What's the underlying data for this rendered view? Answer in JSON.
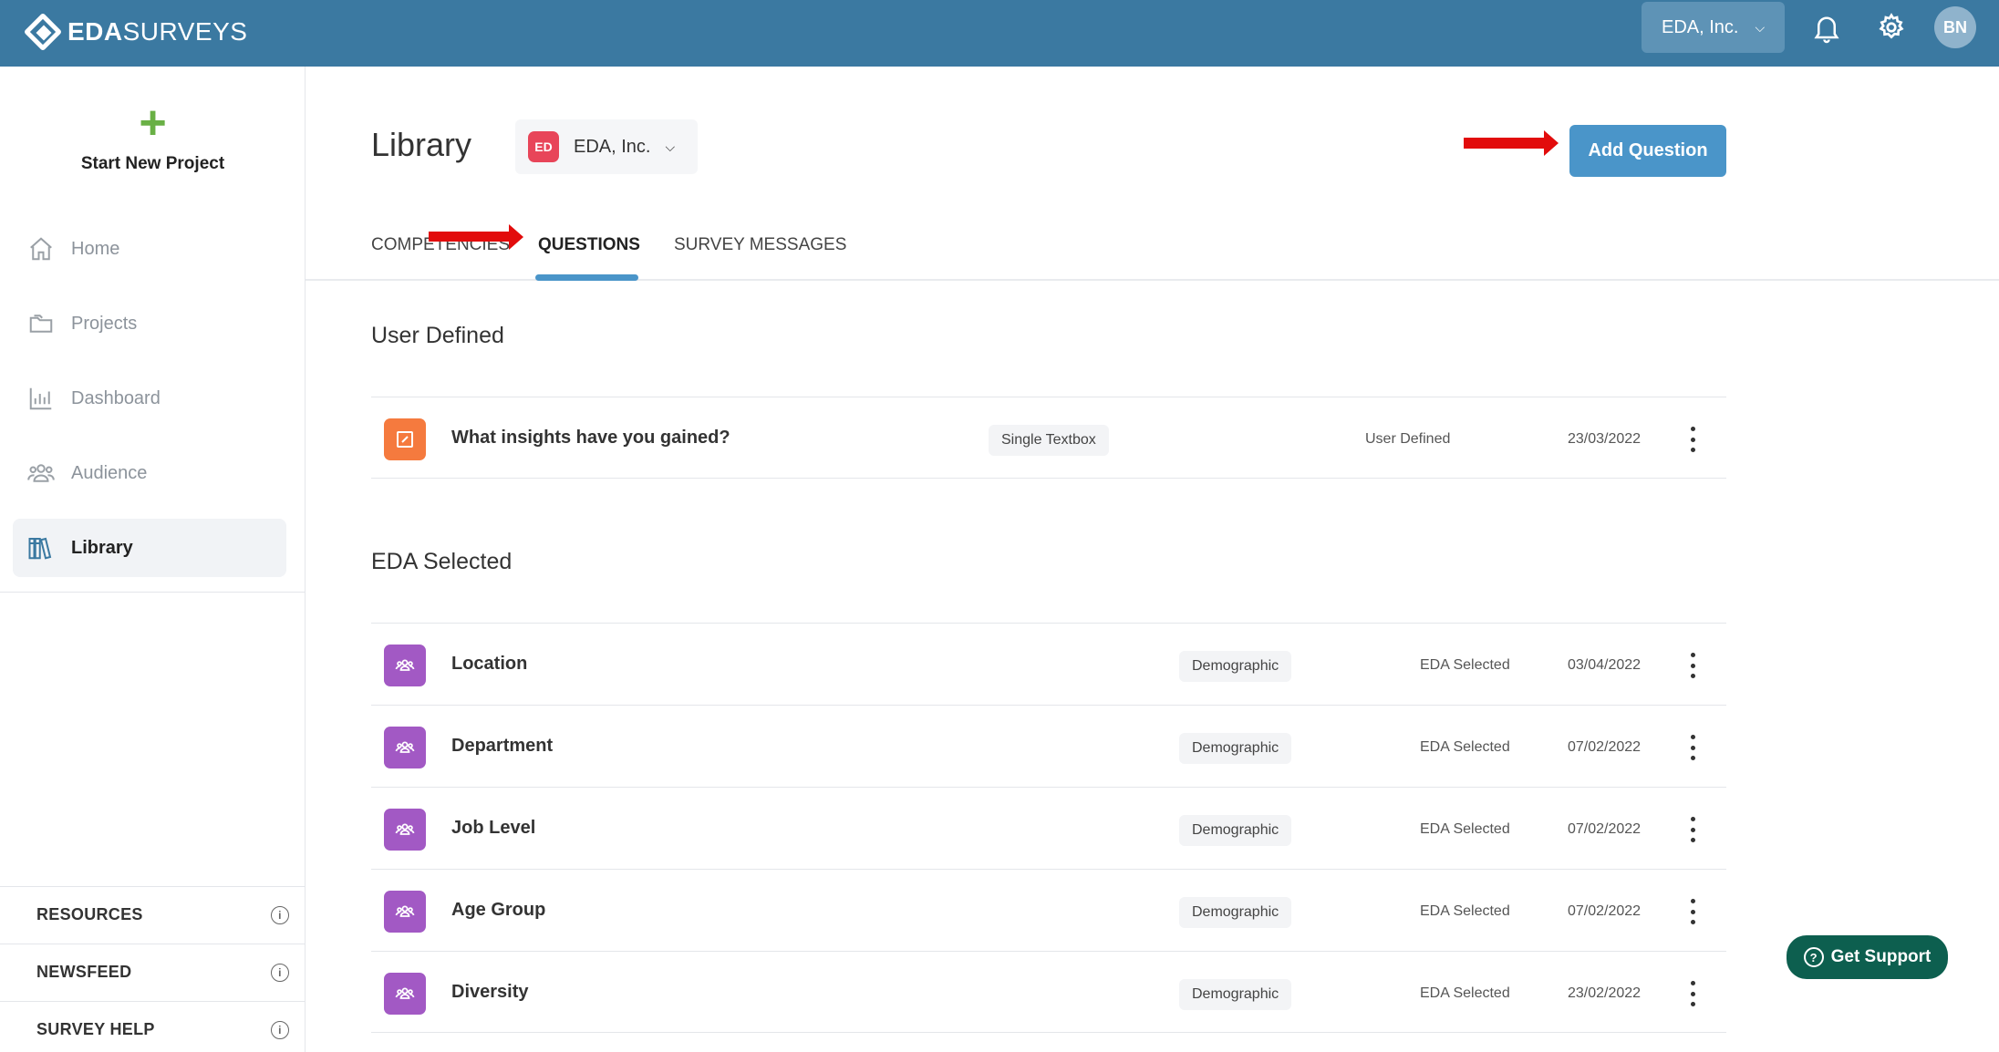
{
  "header": {
    "brand_bold": "EDA",
    "brand_rest": "SURVEYS",
    "org_select": "EDA, Inc.",
    "avatar_initials": "BN"
  },
  "sidebar": {
    "new_project_label": "Start New Project",
    "items": [
      {
        "label": "Home",
        "icon": "home-icon"
      },
      {
        "label": "Projects",
        "icon": "folder-icon"
      },
      {
        "label": "Dashboard",
        "icon": "bar-chart-icon"
      },
      {
        "label": "Audience",
        "icon": "people-icon"
      },
      {
        "label": "Library",
        "icon": "books-icon",
        "active": true
      }
    ],
    "links": [
      {
        "label": "RESOURCES"
      },
      {
        "label": "NEWSFEED"
      },
      {
        "label": "SURVEY HELP"
      }
    ]
  },
  "main": {
    "title": "Library",
    "org_badge": "ED",
    "org_name": "EDA, Inc.",
    "add_button": "Add Question",
    "tabs": [
      {
        "label": "COMPETENCIES"
      },
      {
        "label": "QUESTIONS",
        "active": true
      },
      {
        "label": "SURVEY MESSAGES"
      }
    ],
    "sections": [
      {
        "title": "User Defined",
        "rows": [
          {
            "question": "What insights have you gained?",
            "type": "Single Textbox",
            "source": "User Defined",
            "date": "23/03/2022",
            "icon": "edit-icon"
          }
        ]
      },
      {
        "title": "EDA Selected",
        "rows": [
          {
            "question": "Location",
            "type": "Demographic",
            "source": "EDA Selected",
            "date": "03/04/2022",
            "icon": "people-icon"
          },
          {
            "question": "Department",
            "type": "Demographic",
            "source": "EDA Selected",
            "date": "07/02/2022",
            "icon": "people-icon"
          },
          {
            "question": "Job Level",
            "type": "Demographic",
            "source": "EDA Selected",
            "date": "07/02/2022",
            "icon": "people-icon"
          },
          {
            "question": "Age Group",
            "type": "Demographic",
            "source": "EDA Selected",
            "date": "07/02/2022",
            "icon": "people-icon"
          },
          {
            "question": "Diversity",
            "type": "Demographic",
            "source": "EDA Selected",
            "date": "23/02/2022",
            "icon": "people-icon"
          }
        ]
      }
    ]
  },
  "support": {
    "label": "Get Support",
    "glyph": "?"
  },
  "colors": {
    "topbar": "#3b79a1",
    "accent": "#4a95c9",
    "annotation_arrow": "#e20c0c",
    "orange_icon": "#f57a3e",
    "purple_icon": "#a259c4",
    "support": "#0d5f4f"
  }
}
